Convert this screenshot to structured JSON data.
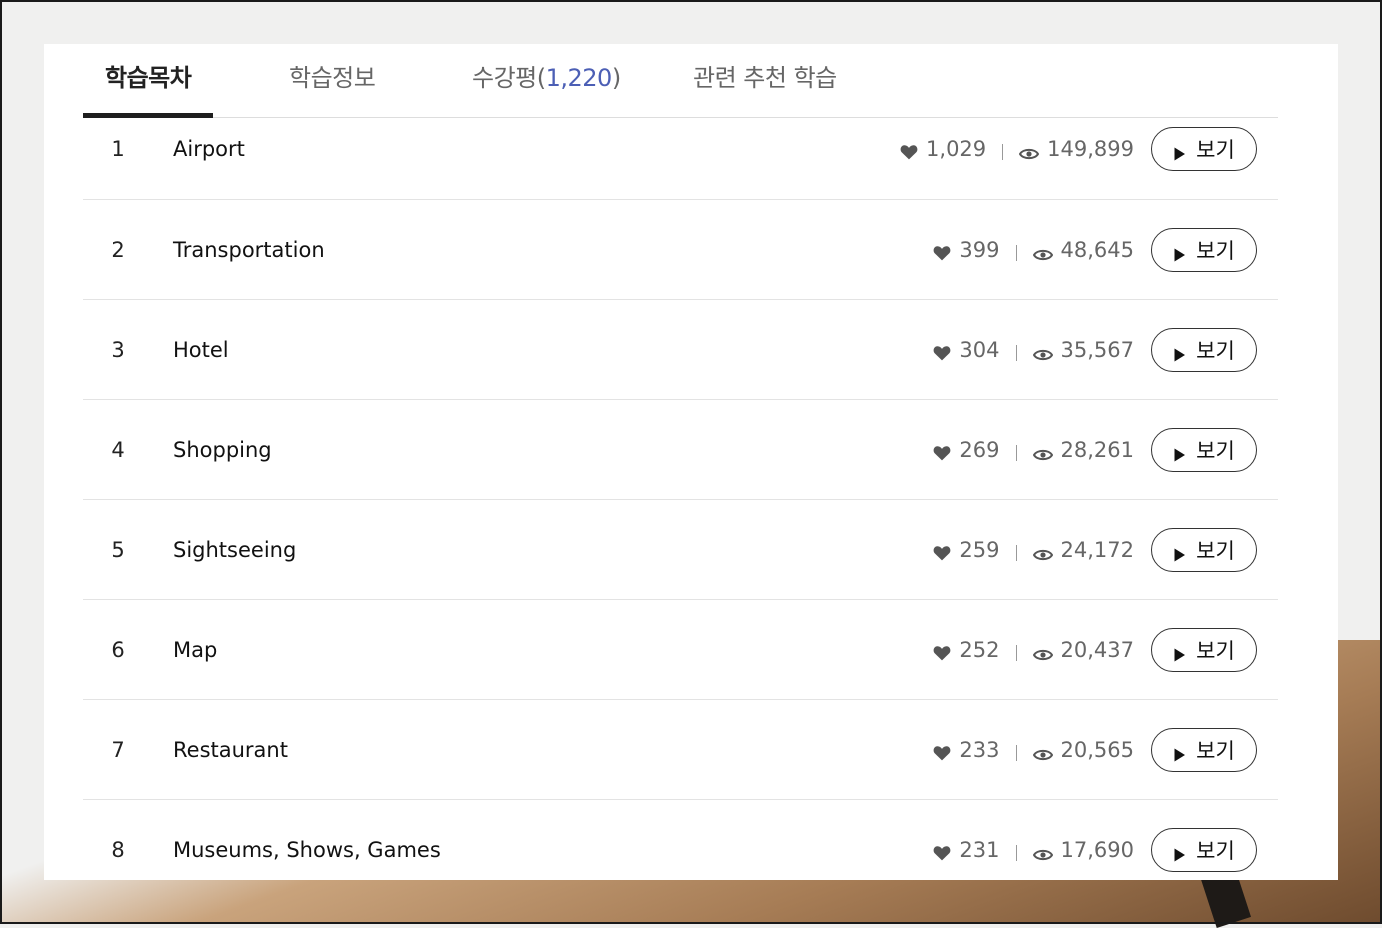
{
  "tabs": [
    {
      "label": "학습목차",
      "active": true
    },
    {
      "label": "학습정보",
      "active": false
    },
    {
      "label": "수강평(",
      "count": "1,220",
      "suffix": ")",
      "active": false
    },
    {
      "label": "관련 추천 학습",
      "active": false
    }
  ],
  "lessons": [
    {
      "number": "1",
      "title": "Airport",
      "likes": "1,029",
      "views": "149,899",
      "button": "보기"
    },
    {
      "number": "2",
      "title": "Transportation",
      "likes": "399",
      "views": "48,645",
      "button": "보기"
    },
    {
      "number": "3",
      "title": "Hotel",
      "likes": "304",
      "views": "35,567",
      "button": "보기"
    },
    {
      "number": "4",
      "title": "Shopping",
      "likes": "269",
      "views": "28,261",
      "button": "보기"
    },
    {
      "number": "5",
      "title": "Sightseeing",
      "likes": "259",
      "views": "24,172",
      "button": "보기"
    },
    {
      "number": "6",
      "title": "Map",
      "likes": "252",
      "views": "20,437",
      "button": "보기"
    },
    {
      "number": "7",
      "title": "Restaurant",
      "likes": "233",
      "views": "20,565",
      "button": "보기"
    },
    {
      "number": "8",
      "title": "Museums, Shows, Games",
      "likes": "231",
      "views": "17,690",
      "button": "보기"
    }
  ],
  "icons": {
    "likes": "heart-icon",
    "views": "eye-icon",
    "play": "play-icon"
  },
  "colors": {
    "accent_count": "#4c5fb5",
    "active_underline": "#1e1e1e",
    "text": "#222222",
    "muted": "#666666"
  }
}
